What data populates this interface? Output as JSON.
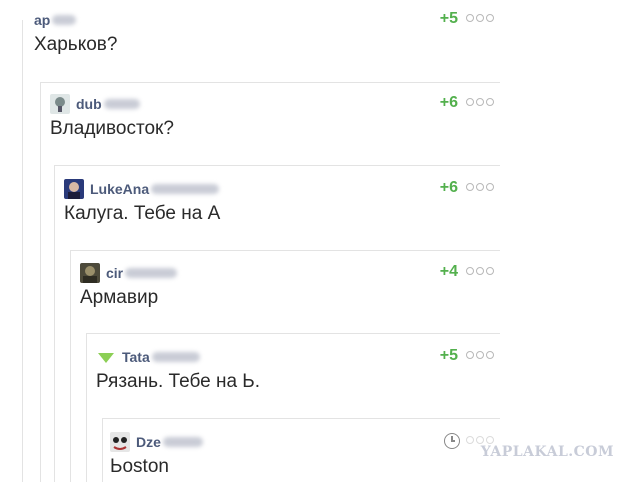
{
  "comments": [
    {
      "user": "ap",
      "text": "Харьков?",
      "rating": "+5"
    },
    {
      "user": "dub",
      "text": "Владивосток?",
      "rating": "+6"
    },
    {
      "user": "LukeAna",
      "text": "Калуга. Тебе на А",
      "rating": "+6"
    },
    {
      "user": "cir",
      "text": "Армавир",
      "rating": "+4"
    },
    {
      "user": "Tata",
      "text": "Рязань. Тебе на Ь.",
      "rating": "+5"
    },
    {
      "user": "Dze",
      "text": "Ьoston",
      "rating": ""
    }
  ],
  "watermark": "YAPLAKAL.COM",
  "colors": {
    "rating": "#53b04d",
    "username": "#4c5a7a",
    "thread_line": "#e3e3e3"
  },
  "icons": {
    "menu": "dots-icon",
    "pending": "clock-icon"
  }
}
